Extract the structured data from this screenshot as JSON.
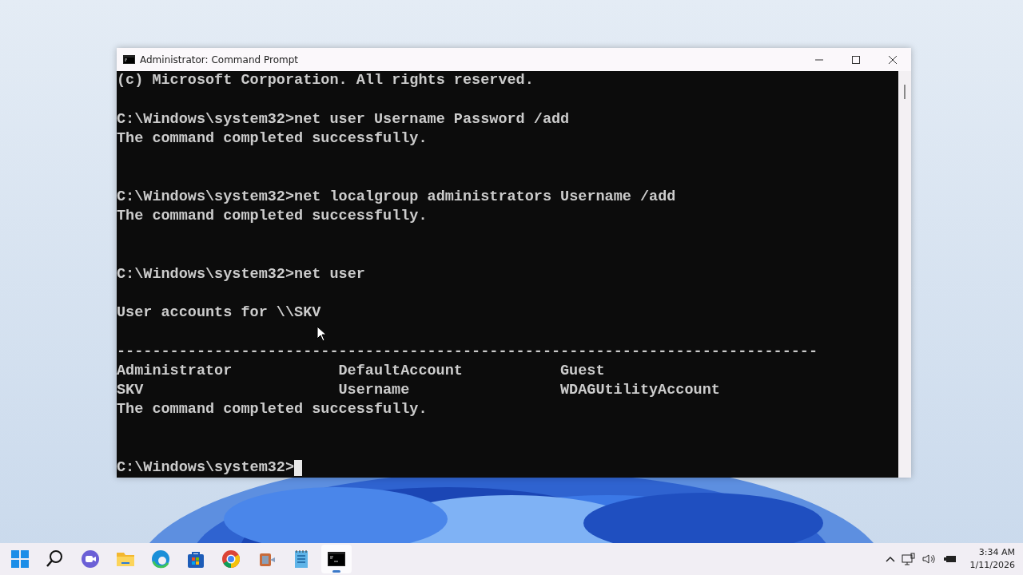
{
  "window": {
    "title": "Administrator: Command Prompt"
  },
  "console": {
    "lines": [
      {
        "kind": "text",
        "text": "(c) Microsoft Corporation. All rights reserved."
      },
      {
        "kind": "blank"
      },
      {
        "kind": "text",
        "text": "C:\\Windows\\system32>net user Username Password /add"
      },
      {
        "kind": "text",
        "text": "The command completed successfully."
      },
      {
        "kind": "blank"
      },
      {
        "kind": "blank"
      },
      {
        "kind": "text",
        "text": "C:\\Windows\\system32>net localgroup administrators Username /add"
      },
      {
        "kind": "text",
        "text": "The command completed successfully."
      },
      {
        "kind": "blank"
      },
      {
        "kind": "blank"
      },
      {
        "kind": "text",
        "text": "C:\\Windows\\system32>net user"
      },
      {
        "kind": "blank"
      },
      {
        "kind": "text",
        "text": "User accounts for \\\\SKV"
      },
      {
        "kind": "blank"
      },
      {
        "kind": "text",
        "text": "-------------------------------------------------------------------------------"
      },
      {
        "kind": "columns",
        "cells": [
          "Administrator",
          "DefaultAccount",
          "Guest"
        ]
      },
      {
        "kind": "columns",
        "cells": [
          "SKV",
          "Username",
          "WDAGUtilityAccount"
        ]
      },
      {
        "kind": "text",
        "text": "The command completed successfully."
      },
      {
        "kind": "blank"
      },
      {
        "kind": "blank"
      },
      {
        "kind": "prompt",
        "text": "C:\\Windows\\system32>"
      }
    ]
  },
  "taskbar": {
    "apps": [
      {
        "kind": "start",
        "selected": false
      },
      {
        "kind": "search",
        "selected": false
      },
      {
        "kind": "chat",
        "selected": false
      },
      {
        "kind": "folder",
        "selected": false
      },
      {
        "kind": "edge",
        "selected": false
      },
      {
        "kind": "store",
        "selected": false
      },
      {
        "kind": "chrome",
        "selected": false
      },
      {
        "kind": "media",
        "selected": false
      },
      {
        "kind": "notepad",
        "selected": false
      },
      {
        "kind": "terminal",
        "selected": true
      }
    ]
  },
  "tray": {
    "time": "3:34 AM",
    "date": "1/11/2026"
  }
}
